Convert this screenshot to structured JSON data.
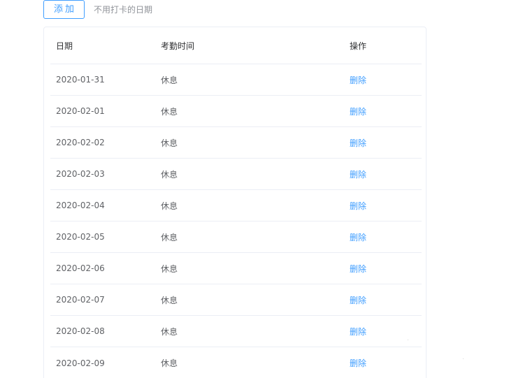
{
  "toolbar": {
    "add_label": "添加",
    "hint": "不用打卡的日期"
  },
  "table": {
    "columns": {
      "date": "日期",
      "time": "考勤时间",
      "op": "操作"
    },
    "rows": [
      {
        "date": "2020-01-31",
        "time": "休息",
        "action": "删除"
      },
      {
        "date": "2020-02-01",
        "time": "休息",
        "action": "删除"
      },
      {
        "date": "2020-02-02",
        "time": "休息",
        "action": "删除"
      },
      {
        "date": "2020-02-03",
        "time": "休息",
        "action": "删除"
      },
      {
        "date": "2020-02-04",
        "time": "休息",
        "action": "删除"
      },
      {
        "date": "2020-02-05",
        "time": "休息",
        "action": "删除"
      },
      {
        "date": "2020-02-06",
        "time": "休息",
        "action": "删除"
      },
      {
        "date": "2020-02-07",
        "time": "休息",
        "action": "删除"
      },
      {
        "date": "2020-02-08",
        "time": "休息",
        "action": "删除"
      },
      {
        "date": "2020-02-09",
        "time": "休息",
        "action": "删除"
      }
    ]
  },
  "colors": {
    "accent": "#409eff",
    "text_primary": "#303133",
    "text_regular": "#606266",
    "text_secondary": "#909399",
    "border": "#ebeef5"
  }
}
